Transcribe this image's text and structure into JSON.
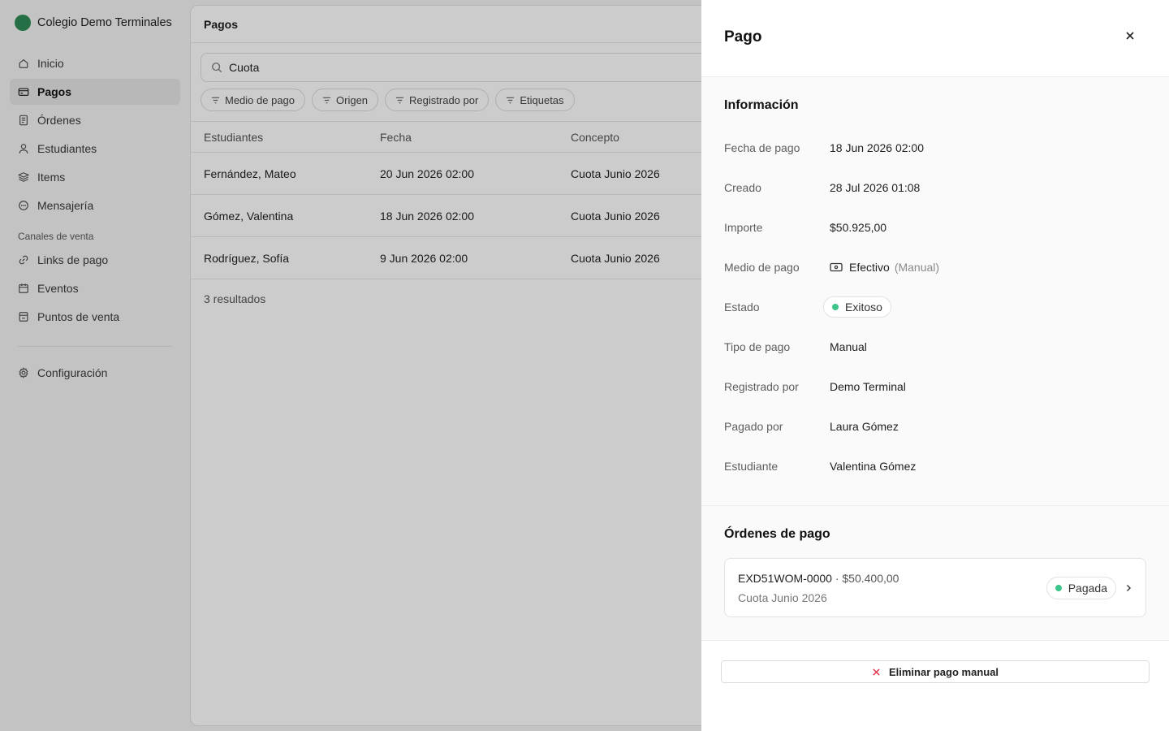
{
  "app": {
    "brand": "Colegio Demo Terminales"
  },
  "sidebar": {
    "items": [
      {
        "label": "Inicio",
        "icon": "home-icon"
      },
      {
        "label": "Pagos",
        "icon": "wallet-icon",
        "active": true
      },
      {
        "label": "Órdenes",
        "icon": "receipt-icon"
      },
      {
        "label": "Estudiantes",
        "icon": "user-icon"
      },
      {
        "label": "Items",
        "icon": "layers-icon"
      },
      {
        "label": "Mensajería",
        "icon": "chat-icon"
      }
    ],
    "section_label": "Canales de venta",
    "channels": [
      {
        "label": "Links de pago",
        "icon": "link-icon"
      },
      {
        "label": "Eventos",
        "icon": "calendar-icon"
      },
      {
        "label": "Puntos de venta",
        "icon": "store-icon"
      }
    ],
    "settings_label": "Configuración"
  },
  "main": {
    "title": "Pagos",
    "search_value": "Cuota",
    "filters": [
      "Medio de pago",
      "Origen",
      "Registrado por",
      "Etiquetas"
    ],
    "columns": [
      "Estudiantes",
      "Fecha",
      "Concepto"
    ],
    "rows": [
      [
        "Fernández, Mateo",
        "20 Jun 2026 02:00",
        "Cuota Junio 2026"
      ],
      [
        "Gómez, Valentina",
        "18 Jun 2026 02:00",
        "Cuota Junio 2026"
      ],
      [
        "Rodríguez, Sofía",
        "9 Jun 2026 02:00",
        "Cuota Junio 2026"
      ]
    ],
    "results": "3 resultados"
  },
  "drawer": {
    "title": "Pago",
    "info_title": "Información",
    "fields": {
      "fecha_label": "Fecha de pago",
      "fecha_value": "18 Jun 2026 02:00",
      "creado_label": "Creado",
      "creado_value": "28 Jul 2026 01:08",
      "importe_label": "Importe",
      "importe_value": "$50.925,00",
      "medio_label": "Medio de pago",
      "medio_value": "Efectivo",
      "medio_note": "(Manual)",
      "estado_label": "Estado",
      "estado_value": "Exitoso",
      "tipo_label": "Tipo de pago",
      "tipo_value": "Manual",
      "registrado_label": "Registrado por",
      "registrado_value": "Demo Terminal",
      "pagado_label": "Pagado por",
      "pagado_value": "Laura Gómez",
      "estudiante_label": "Estudiante",
      "estudiante_value": "Valentina Gómez"
    },
    "orders_title": "Órdenes de pago",
    "order": {
      "code": "EXD51WOM-0000",
      "separator": "·",
      "amount": "$50.400,00",
      "concept": "Cuota Junio 2026",
      "status": "Pagada"
    },
    "delete_label": "Eliminar pago manual"
  },
  "colors": {
    "success": "#3cc48a",
    "danger": "#e0334a",
    "brand": "#2e8b57"
  }
}
